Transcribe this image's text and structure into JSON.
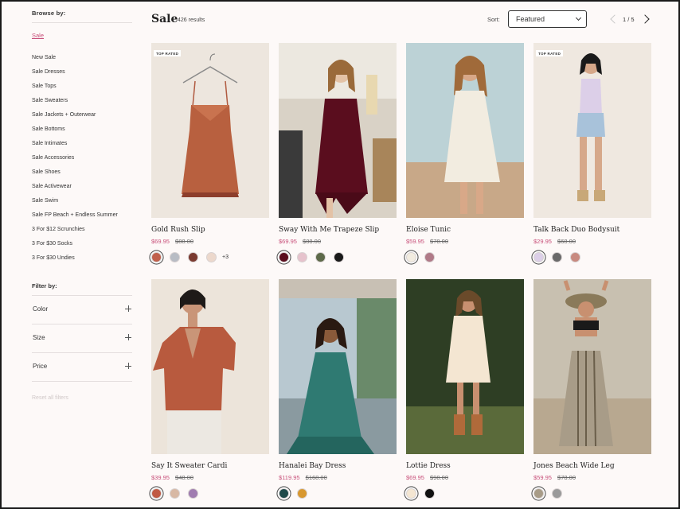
{
  "sidebar": {
    "browse_heading": "Browse by:",
    "sale_link": "Sale",
    "categories": [
      "New Sale",
      "Sale Dresses",
      "Sale Tops",
      "Sale Sweaters",
      "Sale Jackets + Outerwear",
      "Sale Bottoms",
      "Sale Intimates",
      "Sale Accessories",
      "Sale Shoes",
      "Sale Activewear",
      "Sale Swim",
      "Sale FP Beach + Endless Summer",
      "3 For $12 Scrunchies",
      "3 For $30 Socks",
      "3 For $30 Undies"
    ],
    "filter_heading": "Filter by:",
    "filters": [
      "Color",
      "Size",
      "Price"
    ],
    "reset_label": "Reset all filters"
  },
  "header": {
    "title": "Sale",
    "results": "426 results",
    "sort_label": "Sort:",
    "sort_value": "Featured",
    "pager": "1 / 5"
  },
  "colors": {
    "accent_pink": "#c8507a",
    "background": "#fdf9f8"
  },
  "products": [
    {
      "name": "Gold Rush Slip",
      "sale_price": "$69.95",
      "orig_price": "$88.00",
      "badge": "TOP RATED",
      "swatches": [
        "#c0604c",
        "#b8bcc4",
        "#7a3a30",
        "#ecd8cc"
      ],
      "more": "+3"
    },
    {
      "name": "Sway With Me Trapeze Slip",
      "sale_price": "$69.95",
      "orig_price": "$88.00",
      "badge": "",
      "swatches": [
        "#5a0d1e",
        "#e6c2cc",
        "#5e6a4a",
        "#1a1a1a"
      ],
      "more": ""
    },
    {
      "name": "Eloise Tunic",
      "sale_price": "$59.95",
      "orig_price": "$78.00",
      "badge": "",
      "swatches": [
        "#f2ece0",
        "#b07a88"
      ],
      "more": ""
    },
    {
      "name": "Talk Back Duo Bodysuit",
      "sale_price": "$29.95",
      "orig_price": "$68.00",
      "badge": "TOP RATED",
      "swatches": [
        "#dccfe8",
        "#6a6a6a",
        "#c88a80"
      ],
      "more": ""
    },
    {
      "name": "Say It Sweater Cardi",
      "sale_price": "$39.95",
      "orig_price": "$48.00",
      "badge": "",
      "swatches": [
        "#c05a44",
        "#d8b8a4",
        "#a07cb0"
      ],
      "more": ""
    },
    {
      "name": "Hanalei Bay Dress",
      "sale_price": "$119.95",
      "orig_price": "$168.00",
      "badge": "",
      "swatches": [
        "#1f4a4a",
        "#d89830"
      ],
      "more": ""
    },
    {
      "name": "Lottie Dress",
      "sale_price": "$69.95",
      "orig_price": "$98.00",
      "badge": "",
      "swatches": [
        "#f4e6d2",
        "#111111"
      ],
      "more": ""
    },
    {
      "name": "Jones Beach Wide Leg",
      "sale_price": "$59.95",
      "orig_price": "$78.00",
      "badge": "",
      "swatches": [
        "#a89c88",
        "#9a9a9a"
      ],
      "more": ""
    }
  ]
}
